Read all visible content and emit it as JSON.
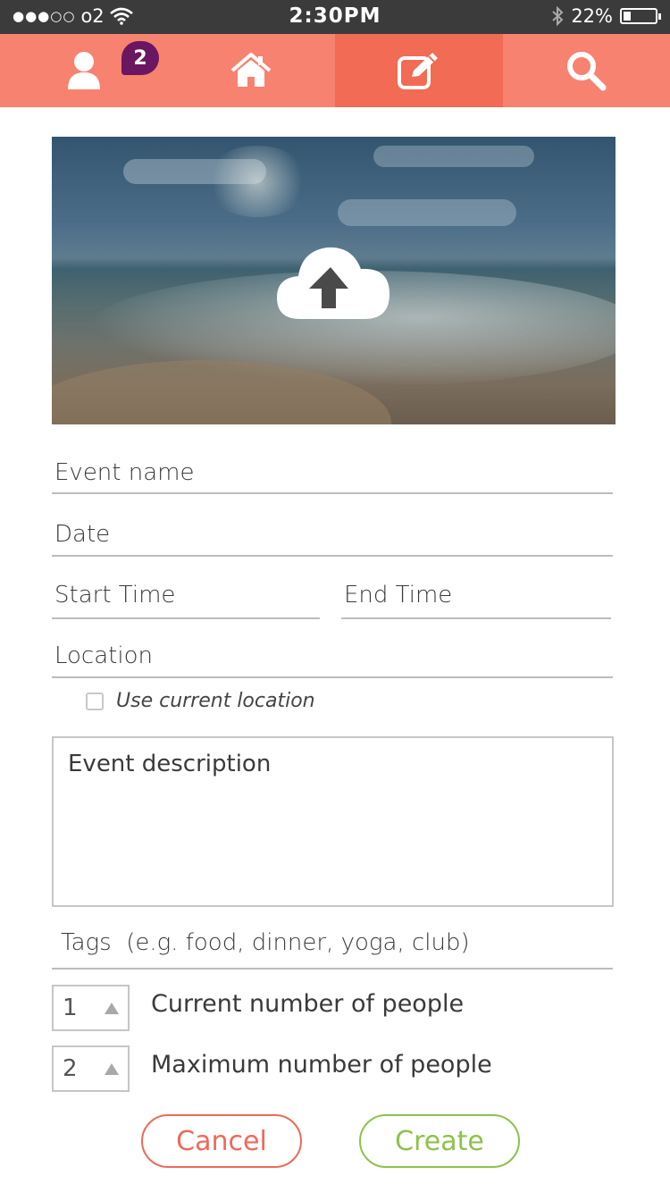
{
  "status_bar": {
    "signal": "●●●○○",
    "carrier": "o2",
    "time": "2:30PM",
    "battery_percent": "22%"
  },
  "nav": {
    "items": [
      {
        "name": "profile",
        "icon": "user-icon"
      },
      {
        "name": "home",
        "icon": "home-icon"
      },
      {
        "name": "create",
        "icon": "edit-icon",
        "active": true
      },
      {
        "name": "search",
        "icon": "search-icon"
      }
    ],
    "badge_count": "2"
  },
  "hero": {
    "upload_icon": "cloud-upload-icon"
  },
  "form": {
    "event_name_placeholder": "Event name",
    "date_placeholder": "Date",
    "start_time_placeholder": "Start Time",
    "end_time_placeholder": "End Time",
    "location_placeholder": "Location",
    "use_current_location_label": "Use current location",
    "use_current_location_checked": false,
    "description_placeholder": "Event description",
    "tags_placeholder": "Tags  (e.g. food, dinner, yoga, club)",
    "current_people": {
      "value": "1",
      "label": "Current number of people"
    },
    "max_people": {
      "value": "2",
      "label": "Maximum number of people"
    }
  },
  "actions": {
    "cancel_label": "Cancel",
    "create_label": "Create"
  },
  "colors": {
    "nav_bg": "#f7826f",
    "nav_active_bg": "#f26b55",
    "badge_bg": "#6b1660",
    "cancel": "#ee6a58",
    "create": "#8dc24a"
  }
}
